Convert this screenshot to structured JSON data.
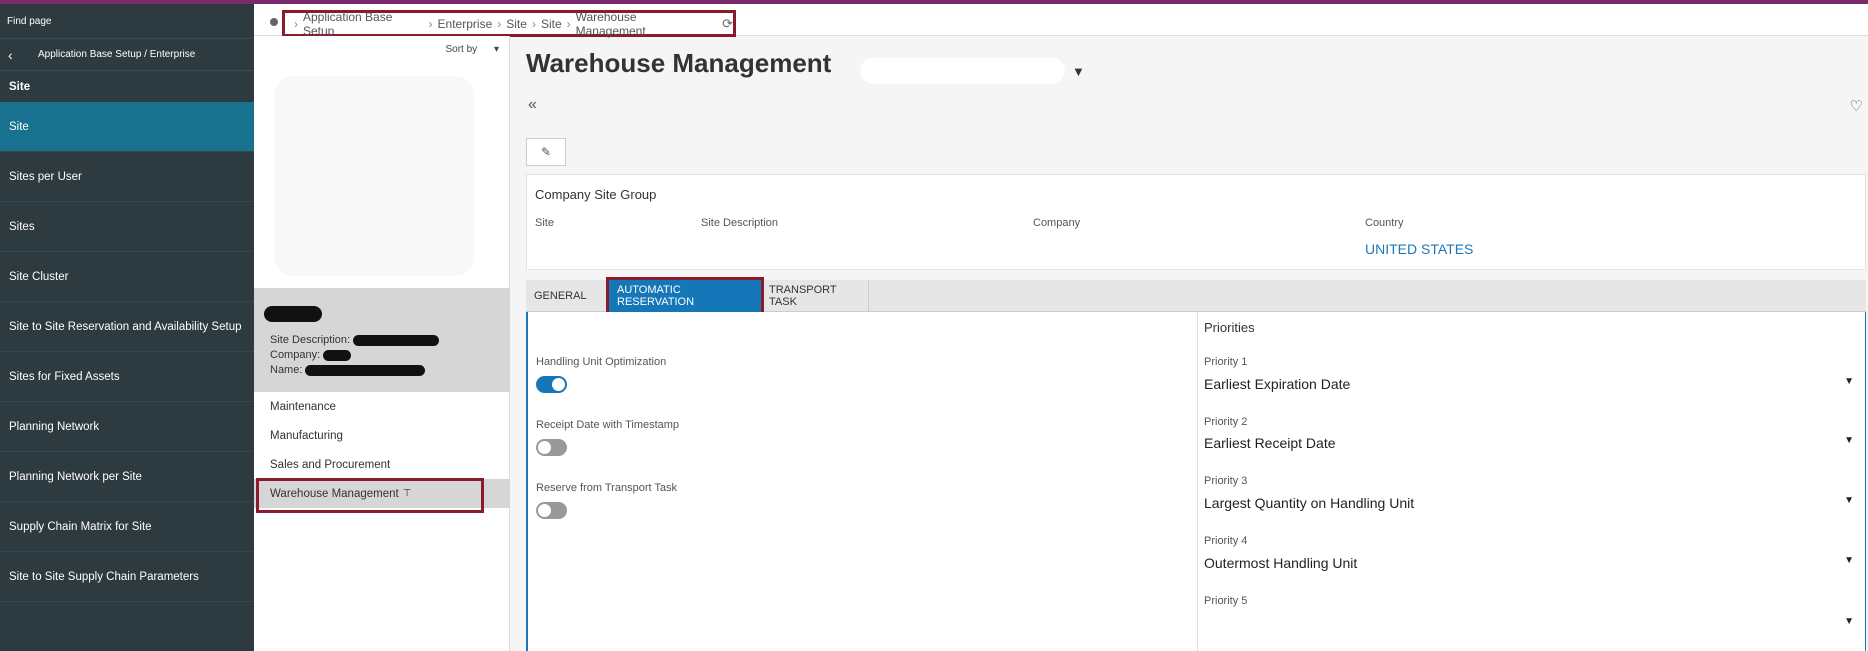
{
  "nav": {
    "find_page": "Find page",
    "breadcrumb": "Application Base Setup / Enterprise",
    "heading": "Site",
    "items": [
      {
        "label": "Site"
      },
      {
        "label": "Sites per User"
      },
      {
        "label": "Sites"
      },
      {
        "label": "Site Cluster"
      },
      {
        "label": "Site to Site Reservation and Availability Setup"
      },
      {
        "label": "Sites for Fixed Assets"
      },
      {
        "label": "Planning Network"
      },
      {
        "label": "Planning Network per Site"
      },
      {
        "label": "Supply Chain Matrix for Site"
      },
      {
        "label": "Site to Site Supply Chain Parameters"
      }
    ]
  },
  "breadcrumb": {
    "items": [
      "Application Base Setup",
      "Enterprise",
      "Site",
      "Site",
      "Warehouse Management"
    ]
  },
  "list": {
    "sort_label": "Sort by",
    "card": {
      "site_description_label": "Site Description:",
      "company_label": "Company:",
      "name_label": "Name:"
    },
    "subnav": [
      "Maintenance",
      "Manufacturing",
      "Sales and Procurement",
      "Warehouse Management"
    ]
  },
  "page": {
    "title": "Warehouse Management"
  },
  "group": {
    "title": "Company Site Group",
    "site_label": "Site",
    "site_desc_label": "Site Description",
    "company_label": "Company",
    "country_label": "Country",
    "country_value": "UNITED STATES"
  },
  "tabs": [
    "GENERAL",
    "AUTOMATIC RESERVATION",
    "TRANSPORT TASK"
  ],
  "reservation": {
    "handling_unit_label": "Handling Unit Optimization",
    "handling_unit_on": true,
    "receipt_label": "Receipt Date with Timestamp",
    "receipt_on": false,
    "transport_label": "Reserve from Transport Task",
    "transport_on": false
  },
  "priorities": {
    "title": "Priorities",
    "items": [
      {
        "label": "Priority 1",
        "value": "Earliest Expiration Date"
      },
      {
        "label": "Priority 2",
        "value": "Earliest Receipt Date"
      },
      {
        "label": "Priority 3",
        "value": "Largest Quantity on Handling Unit"
      },
      {
        "label": "Priority 4",
        "value": "Outermost Handling Unit"
      },
      {
        "label": "Priority 5",
        "value": ""
      }
    ]
  },
  "colors": {
    "accent": "#1677b8",
    "nav_bg": "#2d3a40",
    "highlight_box": "#8b1a2c"
  }
}
